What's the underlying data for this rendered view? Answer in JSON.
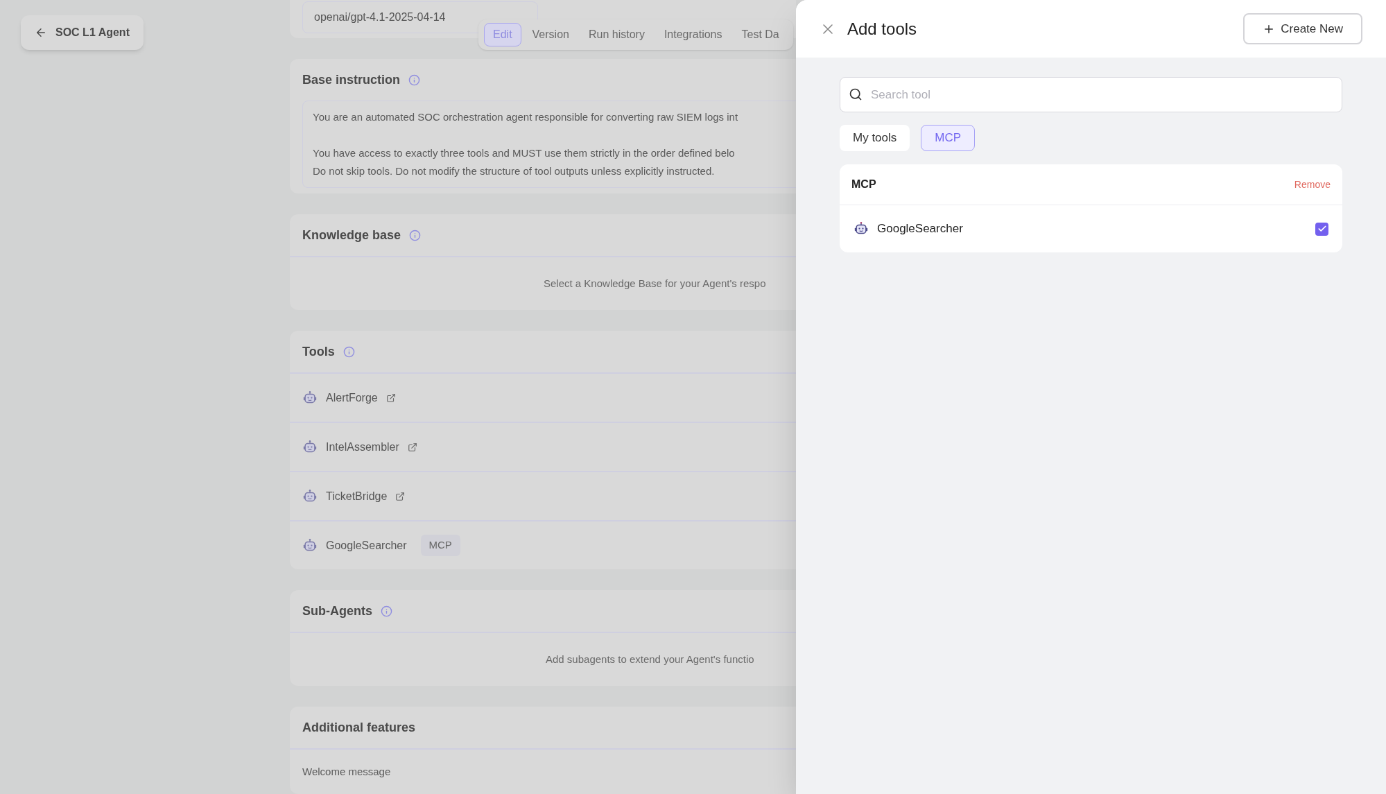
{
  "back_button": {
    "label": "SOC L1 Agent"
  },
  "model_field": {
    "value": "openai/gpt-4.1-2025-04-14"
  },
  "tabs": [
    {
      "label": "Edit",
      "selected": true
    },
    {
      "label": "Version",
      "selected": false
    },
    {
      "label": "Run history",
      "selected": false
    },
    {
      "label": "Integrations",
      "selected": false
    },
    {
      "label": "Test Da",
      "selected": false
    }
  ],
  "base_instruction": {
    "title": "Base instruction",
    "paragraphs": [
      [
        "You are an automated SOC orchestration agent responsible for converting raw SIEM logs int"
      ],
      [
        "You have access to exactly three tools and MUST use them strictly in the order defined belo",
        "Do not skip tools. Do not modify the structure of tool outputs unless explicitly instructed."
      ]
    ]
  },
  "knowledge_base": {
    "title": "Knowledge base",
    "empty_text": "Select a Knowledge Base for your Agent's respo"
  },
  "tools": {
    "title": "Tools",
    "items": [
      {
        "name": "AlertForge",
        "kind": "link"
      },
      {
        "name": "IntelAssembler",
        "kind": "link"
      },
      {
        "name": "TicketBridge",
        "kind": "link"
      },
      {
        "name": "GoogleSearcher",
        "kind": "badge",
        "badge": "MCP"
      }
    ]
  },
  "sub_agents": {
    "title": "Sub-Agents",
    "empty_text": "Add subagents to extend your Agent's functio"
  },
  "additional_features": {
    "title": "Additional features",
    "items": [
      "Welcome message"
    ]
  },
  "panel": {
    "title": "Add tools",
    "create_button": "Create New",
    "search": {
      "placeholder": "Search tool"
    },
    "filters": [
      {
        "label": "My tools",
        "selected": false
      },
      {
        "label": "MCP",
        "selected": true
      }
    ],
    "group": {
      "title": "MCP",
      "action": "Remove",
      "items": [
        {
          "name": "GoogleSearcher",
          "checked": true
        }
      ]
    }
  }
}
